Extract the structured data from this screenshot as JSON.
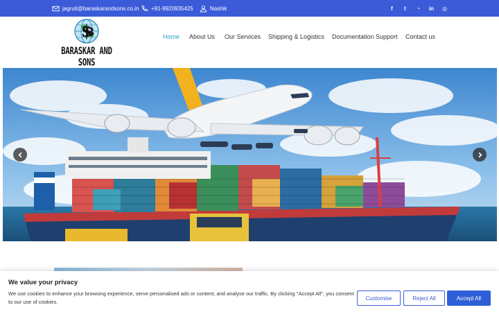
{
  "topbar": {
    "email": "jagruti@baraskarandsons.co.in",
    "phone": "+91-9920935425",
    "location": "Nashik",
    "social": [
      {
        "icon": "facebook-icon",
        "glyph": "f"
      },
      {
        "icon": "twitter-icon",
        "glyph": "t"
      },
      {
        "icon": "rss-icon",
        "glyph": "◔"
      },
      {
        "icon": "linkedin-icon",
        "glyph": "in"
      },
      {
        "icon": "instagram-icon",
        "glyph": "◎"
      }
    ],
    "colors": {
      "background": "#3b5bd9"
    }
  },
  "logo": {
    "text": "BARASKAR AND SONS"
  },
  "nav": {
    "items": [
      {
        "label": "Home",
        "active": true
      },
      {
        "label": "About Us"
      },
      {
        "label": "Our Services"
      },
      {
        "label": "Shipping & Logistics"
      },
      {
        "label": "Documentation Support"
      },
      {
        "label": "Contact us"
      }
    ],
    "colors": {
      "active": "#2aa0c9"
    }
  },
  "hero": {
    "prev_icon": "chevron-left-icon",
    "next_icon": "chevron-right-icon"
  },
  "cookie": {
    "title": "We value your privacy",
    "text": "We use cookies to enhance your browsing experience, serve personalised ads or content, and analyse our traffic. By clicking \"Accept All\", you consent to our use of cookies.",
    "customise": "Customise",
    "reject": "Reject All",
    "accept": "Accept All",
    "colors": {
      "primary": "#2f5fd6"
    }
  }
}
